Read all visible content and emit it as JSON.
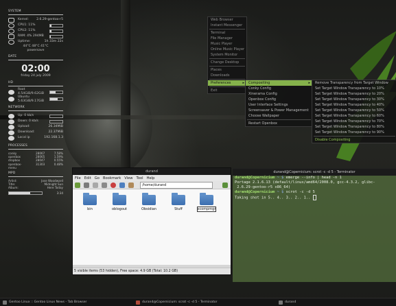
{
  "conky": {
    "system_title": "SYSTEM",
    "kernel_label": "Kernel:",
    "kernel_value": "2.6.29-gentoo-r5",
    "cpu1_label": "CPU1: 11%",
    "cpu2_label": "CPU2: 11%",
    "cpu1_percent": 11,
    "cpu2_percent": 11,
    "ram_label": "RAM: 4% 294MB",
    "ram_percent": 4,
    "uptime_label": "Uptime:",
    "uptime_value": "1h 33m 22s",
    "temps": "44°C   48°C   41°C",
    "powersave": "powersave",
    "date_title": "DATE",
    "time": "02:00",
    "date": "friday 24 july 2009",
    "hd_title": "HD",
    "root_label": "Root",
    "root_value": "4.54GiB/9.62GiB",
    "root_percent": 47,
    "ubuntu_label": "Ubuntu",
    "ubuntu_value": "5.63GiB/9.17GiB",
    "ubuntu_percent": 61,
    "network_title": "NETWORK",
    "up_label": "Up: 0 kb/s",
    "down_label": "Down: 0 kb/s",
    "upload_label": "Upload:",
    "upload_value": "26.34MiB",
    "download_label": "Download:",
    "download_value": "22.37MiB",
    "localip_label": "Local ip",
    "localip_value": "192.168.1.3",
    "processes_title": "PROCESSES",
    "processes": [
      [
        "conky",
        "28067",
        "7.58%"
      ],
      [
        "openbox",
        "28065",
        "1.59%"
      ],
      [
        "dropbox",
        "28047",
        "0.55%"
      ],
      [
        "openbox-menu",
        "31303",
        "0.48%"
      ]
    ],
    "mpd_title": "MPD",
    "mpd": [
      [
        "Artist:",
        "Jose Woodward"
      ],
      [
        "Title:",
        "Midnight Sun"
      ],
      [
        "Album:",
        "Here Today"
      ]
    ],
    "mpd_percent": 65,
    "mpd_time": "3:34"
  },
  "menu_main": [
    {
      "label": "Web Browser",
      "dim": true
    },
    {
      "label": "Instant Messenger",
      "dim": true
    },
    {
      "sep": true
    },
    {
      "label": "Terminal",
      "dim": true
    },
    {
      "label": "File Manager",
      "dim": true
    },
    {
      "label": "Music Player",
      "dim": true
    },
    {
      "label": "Online Music Player",
      "dim": true
    },
    {
      "label": "System Monitor",
      "dim": true
    },
    {
      "sep": true
    },
    {
      "label": "Change Desktop",
      "dim": true
    },
    {
      "sep": true
    },
    {
      "label": "Places",
      "dim": true
    },
    {
      "label": "Downloads",
      "dim": true
    },
    {
      "sep": true
    },
    {
      "label": "Preferences",
      "sel": true,
      "sub": true
    },
    {
      "sep": true
    },
    {
      "label": "Exit",
      "dim": true
    }
  ],
  "menu_prefs": [
    {
      "label": "Compositing",
      "sel": true,
      "sub": true
    },
    {
      "label": "Conky Config"
    },
    {
      "label": "Xinerama Config"
    },
    {
      "label": "Openbox Config"
    },
    {
      "label": "User Interface Settings"
    },
    {
      "label": "Screensaver & Power Management"
    },
    {
      "label": "Choose Wallpaper"
    },
    {
      "sep": true
    },
    {
      "label": "Restart Openbox"
    }
  ],
  "menu_comp": [
    {
      "label": "Remove Transparency from Target Window"
    },
    {
      "label": "Set Target Window Transparency to 10%"
    },
    {
      "label": "Set Target Window Transparency to 20%"
    },
    {
      "label": "Set Target Window Transparency to 30%"
    },
    {
      "label": "Set Target Window Transparency to 40%"
    },
    {
      "label": "Set Target Window Transparency to 50%"
    },
    {
      "label": "Set Target Window Transparency to 60%"
    },
    {
      "label": "Set Target Window Transparency to 70%"
    },
    {
      "label": "Set Target Window Transparency to 80%"
    },
    {
      "label": "Set Target Window Transparency to 90%"
    },
    {
      "sep": true
    },
    {
      "label": "Disable Compositing",
      "green": true
    }
  ],
  "nautilus": {
    "title": "durand",
    "menus": [
      "File",
      "Edit",
      "Go",
      "Bookmark",
      "View",
      "Tool",
      "Help"
    ],
    "location": "/home/durand",
    "folders": [
      "bin",
      "oblogout",
      "Obsidian",
      "Stuff",
      "xcompmgr"
    ],
    "selected_folder": "xcompmgr",
    "status": "5 visible items (53 hidden), Free space: 4.9 GB (Total: 10.2 GB)"
  },
  "terminal": {
    "title": "durand@Copernicium: scrot -c -d 5 - Terminator",
    "prompt1_user": "durand@Copernicium",
    "prompt1_dir": " ~ $ ",
    "cmd1": "emerge --info | head -n 1",
    "out1": "Portage 2.1.6.13 (default/linux/amd64/2008.0, gcc-4.3.2, glibc-",
    "out2": " 2.6.29-gentoo-r5 x86_64)",
    "prompt2_user": "durand@Copernicium",
    "prompt2_dir": " ~ $ ",
    "cmd2": "scrot -c -d 5",
    "out3": "Taking shot in 5.. 4.. 3.. 2.. 1.. "
  },
  "taskbar": {
    "task1": "Gentoo Linux :: Gentoo Linux News - Tab Browser",
    "task2": "durand@Copernicium: scrot -c -d 5 - Terminator",
    "task3": "durand"
  },
  "colors": {
    "menu_select": "#85b24b",
    "terminal_bg": "#688c48"
  }
}
